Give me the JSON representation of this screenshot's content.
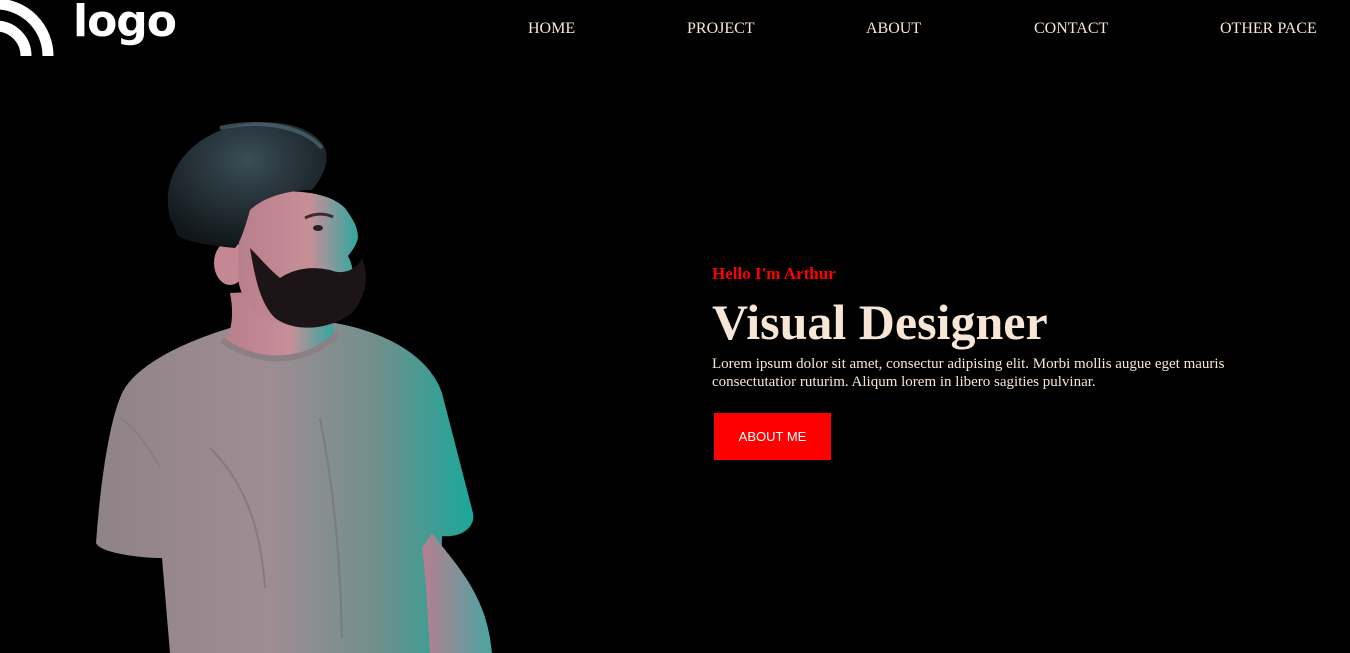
{
  "brand": {
    "logo_text": "logo",
    "logo_icon": "wifi-arcs-icon"
  },
  "nav": {
    "items": [
      {
        "label": "HOME"
      },
      {
        "label": "PROJECT"
      },
      {
        "label": "ABOUT"
      },
      {
        "label": "CONTACT"
      },
      {
        "label": "OTHER PACE"
      }
    ]
  },
  "hero": {
    "greeting": "Hello I'm Arthur",
    "title": "Visual Designer",
    "description": "Lorem ipsum dolor sit amet, consectur adipising elit. Morbi mollis augue eget mauris consectutatior ruturim. Aliqum lorem in libero sagities pulvinar.",
    "cta_label": "ABOUT ME"
  },
  "colors": {
    "background": "#000000",
    "accent": "#ff0000",
    "text": "#f7e6d6"
  }
}
